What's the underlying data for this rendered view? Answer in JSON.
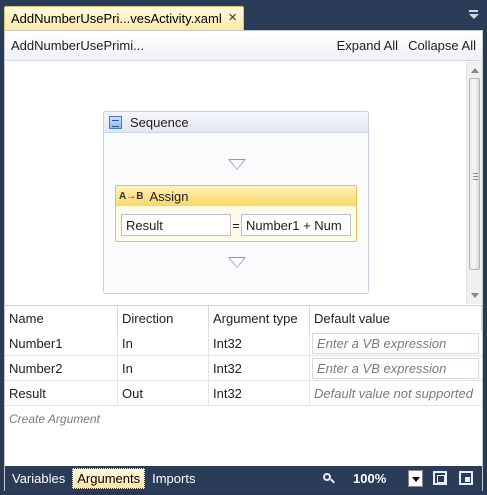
{
  "document_tab": {
    "title": "AddNumberUsePri...vesActivity.xaml",
    "close_glyph": "×"
  },
  "designer": {
    "breadcrumb": "AddNumberUsePrimi...",
    "expand_all": "Expand All",
    "collapse_all": "Collapse All"
  },
  "sequence": {
    "title": "Sequence",
    "icon": "sequence-icon"
  },
  "assign": {
    "icon_text": "A→B",
    "title": "Assign",
    "to": "Result",
    "equals": "=",
    "value": "Number1 + Num"
  },
  "arguments": {
    "columns": [
      "Name",
      "Direction",
      "Argument type",
      "Default value"
    ],
    "rows": [
      {
        "name": "Number1",
        "direction": "In",
        "type": "Int32",
        "default": "Enter a VB expression"
      },
      {
        "name": "Number2",
        "direction": "In",
        "type": "Int32",
        "default": "Enter a VB expression"
      },
      {
        "name": "Result",
        "direction": "Out",
        "type": "Int32",
        "default": "Default value not supported"
      }
    ],
    "create_label": "Create Argument"
  },
  "bottom_bar": {
    "tabs": [
      "Variables",
      "Arguments",
      "Imports"
    ],
    "active_tab": "Arguments",
    "zoom": "100%"
  },
  "colors": {
    "chrome": "#2b3c59",
    "tab_active": "#ffe8a6",
    "assign_header": "#fbd766"
  }
}
